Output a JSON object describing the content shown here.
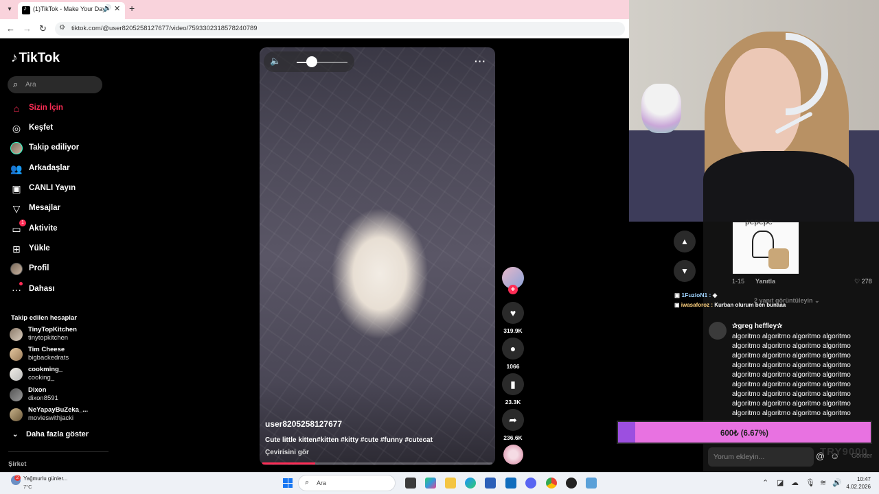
{
  "browser": {
    "tab_title": "(1)TikTok - Make Your Day",
    "url": "tiktok.com/@user8205258127677/video/7593302318578240789"
  },
  "tiktok": {
    "logo": "TikTok",
    "search_placeholder": "Ara",
    "nav": [
      {
        "label": "Sizin İçin",
        "icon": "home-icon"
      },
      {
        "label": "Keşfet",
        "icon": "compass-icon"
      },
      {
        "label": "Takip ediliyor",
        "icon": "avatar"
      },
      {
        "label": "Arkadaşlar",
        "icon": "friends-icon"
      },
      {
        "label": "CANLI Yayın",
        "icon": "live-icon"
      },
      {
        "label": "Mesajlar",
        "icon": "send-icon"
      },
      {
        "label": "Aktivite",
        "icon": "inbox-icon",
        "badge": "1"
      },
      {
        "label": "Yükle",
        "icon": "upload-icon"
      },
      {
        "label": "Profil",
        "icon": "avatar"
      },
      {
        "label": "Dahası",
        "icon": "more-icon"
      }
    ],
    "following_title": "Takip edilen hesaplar",
    "following": [
      {
        "name": "TinyTopKitchen",
        "handle": "tinytopkitchen"
      },
      {
        "name": "Tim Cheese",
        "handle": "bigbackedrats"
      },
      {
        "name": "cookming_",
        "handle": "cooking_"
      },
      {
        "name": "Dixon",
        "handle": "dixon8591"
      },
      {
        "name": "NeYapayBuZeka_...",
        "handle": "movieswithjacki"
      }
    ],
    "show_more": "Daha fazla göster",
    "company": "Şirket"
  },
  "video": {
    "username": "user8205258127677",
    "description": "Cute little kitten#kitten #kitty #cute #funny #cutecat",
    "translate": "Çevirisini gör",
    "progress": 0.23,
    "volume": 0.3,
    "actions": {
      "likes": "319.9K",
      "comments": "1066",
      "saves": "23.3K",
      "shares": "236.6K"
    }
  },
  "comments": {
    "meme_caption": "pepepe",
    "c1_date": "1-15",
    "c1_reply": "Yanıtla",
    "c1_likes": "278",
    "c1_view_replies": "2 yanıt görüntüleyin",
    "chat1_user": "1FuzioN1 :",
    "chat2_user": "iwasaforoz :",
    "chat2_text": "Kurban olurum ben bunaaa",
    "c2_name": "✰greg heffley✰",
    "c2_body": "algoritmo algoritmo algoritmo algoritmo algoritmo algoritmo algoritmo algoritmo algoritmo algoritmo algoritmo algoritmo algoritmo algoritmo algoritmo algoritmo algoritmo algoritmo algoritmo algoritmo algoritmo algoritmo algoritmo algoritmo algoritmo algoritmo algoritmo algoritmo algoritmo algoritmo algoritmo algoritmo algoritmo algoritmo algoritmo algoritmo",
    "donation": "600₺ (6.67%)",
    "donation_progress": 0.0667,
    "input_placeholder": "Yorum ekleyin...",
    "goal_label": "TRY9000",
    "send_label": "Gönder"
  },
  "taskbar": {
    "weather_title": "Yağmurlu günler...",
    "weather_temp": "7°C",
    "weather_badge": "2",
    "search": "Ara",
    "time": "10:47",
    "date": "4.02.2026"
  },
  "colors": {
    "accent": "#fe2c55",
    "donation_bar": "#e872e1",
    "donation_fill": "#9c4fe0"
  }
}
